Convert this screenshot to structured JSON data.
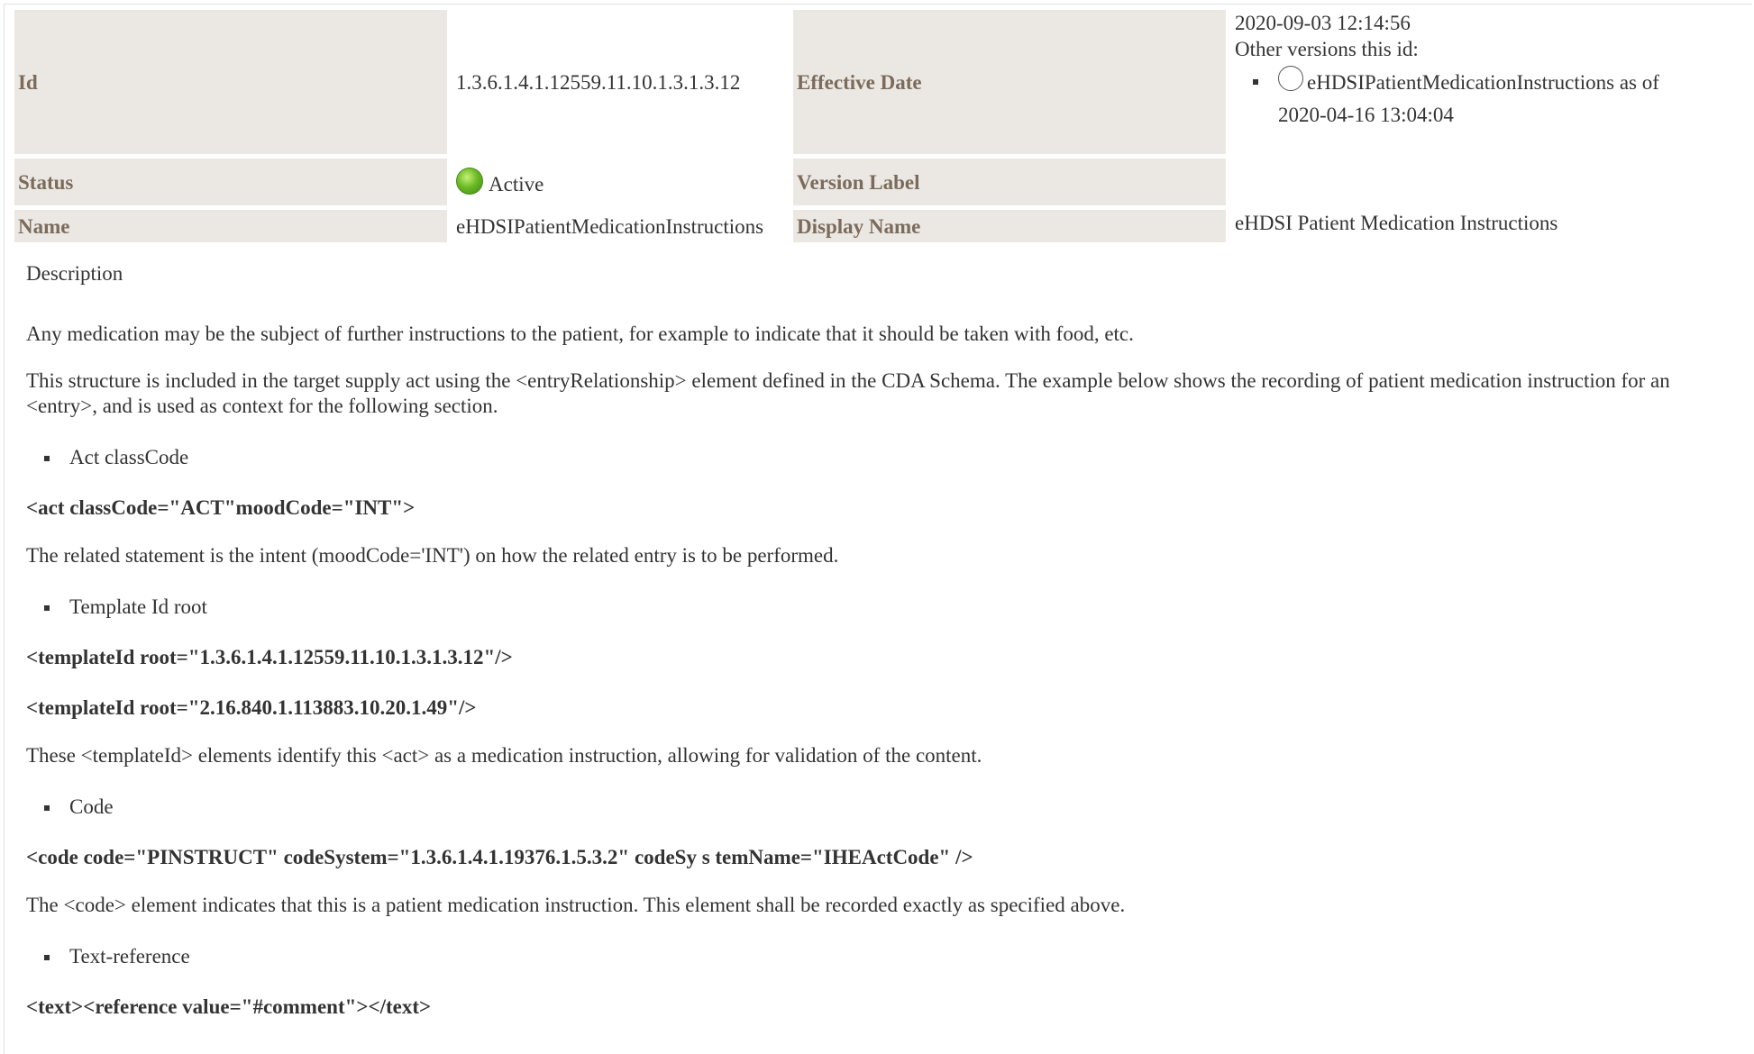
{
  "meta": {
    "id_label": "Id",
    "id_value": "1.3.6.1.4.1.12559.11.10.1.3.1.3.12",
    "effective_date_label": "Effective Date",
    "effective_date_value": "2020-09-03 12:14:56",
    "other_versions_label": "Other versions this id:",
    "other_version_name": "eHDSIPatientMedicationInstructions as of",
    "other_version_date": "2020-04-16 13:04:04",
    "status_label": "Status",
    "status_value": "Active",
    "version_label_label": "Version Label",
    "version_label_value": "",
    "name_label": "Name",
    "name_value": "eHDSIPatientMedicationInstructions",
    "display_name_label": "Display Name",
    "display_name_value": "eHDSI Patient Medication Instructions"
  },
  "description": {
    "heading": "Description",
    "p1": "Any medication may be the subject of further instructions to the patient, for example to indicate that it should be taken with food, etc.",
    "p2": "This structure is included in the target supply act using the <entryRelationship> element defined in the CDA Schema. The example below shows the recording of patient medication instruction for an <entry>, and is used as context for the following section.",
    "b1": "Act classCode",
    "code1": "<act classCode=\"ACT\"moodCode=\"INT\">",
    "p3": "The related statement is the intent (moodCode='INT') on how the related entry is to be performed.",
    "b2": "Template Id root",
    "code2": "<templateId root=\"1.3.6.1.4.1.12559.11.10.1.3.1.3.12\"/>",
    "code3": "<templateId root=\"2.16.840.1.113883.10.20.1.49\"/>",
    "p4": "These <templateId> elements identify this <act> as a medication instruction, allowing for validation of the content.",
    "b3": "Code",
    "code4": "<code code=\"PINSTRUCT\" codeSystem=\"1.3.6.1.4.1.19376.1.5.3.2\" codeSy s temName=\"IHEActCode\" />",
    "p5": "The <code> element indicates that this is a patient medication instruction. This element shall be recorded exactly as specified above.",
    "b4": "Text-reference",
    "code5": "<text><reference value=\"#comment\"></text>"
  },
  "icons": {
    "status_icon": "green-ball-icon",
    "version_icon": "empty-circle-icon"
  },
  "colors": {
    "label_bg": "#ebe8e4",
    "label_text": "#7b6b5b",
    "body_text": "#333333"
  }
}
